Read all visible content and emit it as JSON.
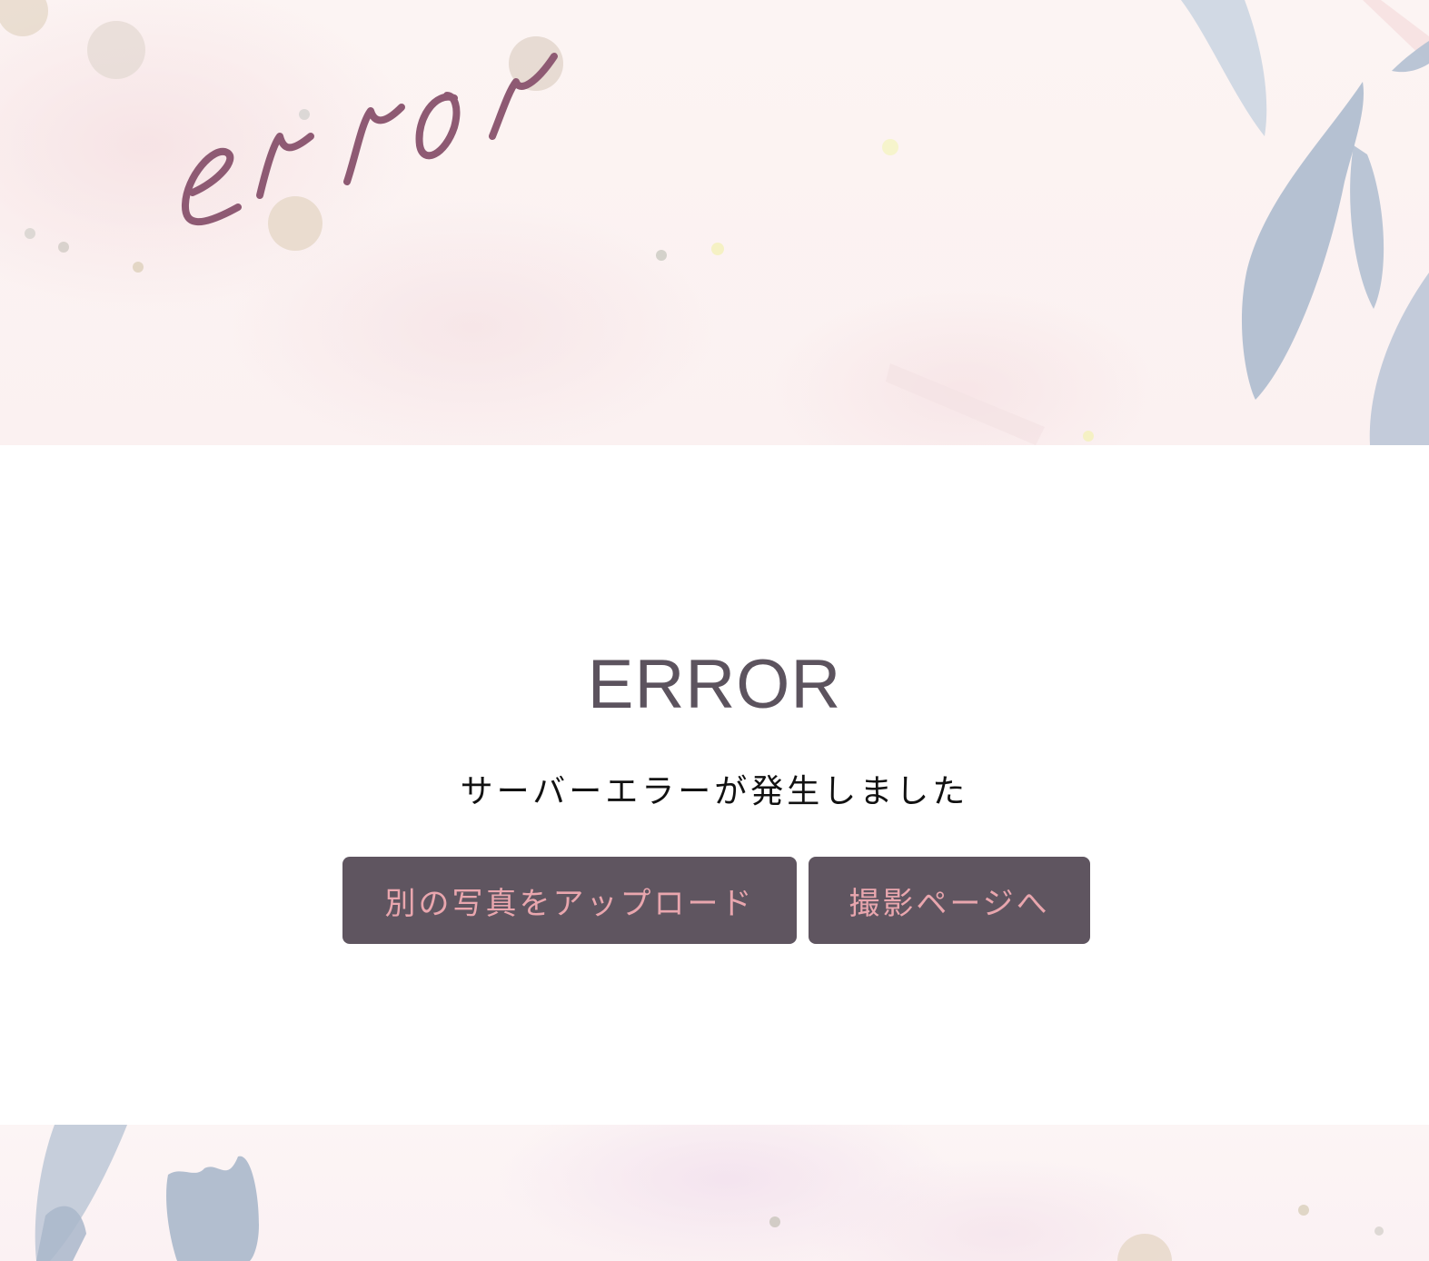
{
  "header": {
    "decor_word": "error"
  },
  "main": {
    "title": "ERROR",
    "message": "サーバーエラーが発生しました",
    "buttons": {
      "upload_label": "別の写真をアップロード",
      "camera_label": "撮影ページへ"
    }
  },
  "colors": {
    "button_bg": "#5f5560",
    "button_text": "#e9a6ae",
    "title": "#5c535e",
    "script_word": "#8e5a73",
    "leaf": "#aebbcf"
  }
}
